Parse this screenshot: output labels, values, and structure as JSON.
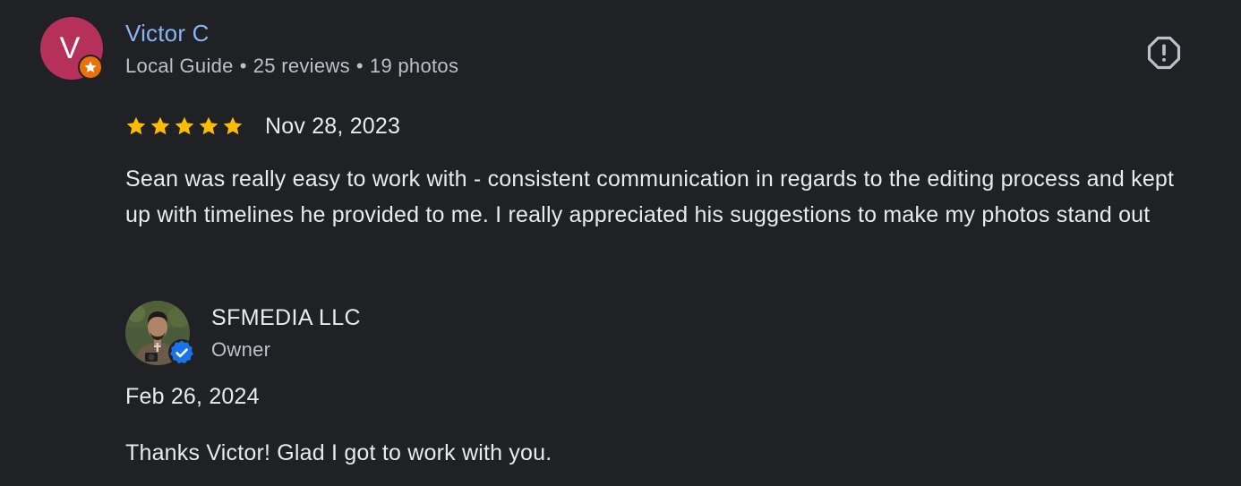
{
  "review": {
    "reviewer": {
      "avatar_letter": "V",
      "avatar_color": "#b5305b",
      "badge_icon": "local-guide-star-icon",
      "name": "Victor C",
      "name_color": "#8ab4f8",
      "level": "Local Guide",
      "reviews": "25 reviews",
      "photos": "19 photos",
      "separator": "•"
    },
    "report_icon": "report-flag-icon",
    "rating": 5,
    "max_rating": 5,
    "star_color": "#fbbc04",
    "date": "Nov 28, 2023",
    "text": "Sean was really easy to work with - consistent communication in regards to the editing process and kept up with timelines he provided to me. I really appreciated his suggestions to make my photos stand out"
  },
  "owner_response": {
    "name": "SFMEDIA LLC",
    "role": "Owner",
    "verified_icon": "verified-badge-icon",
    "verified_color": "#1a73e8",
    "date": "Feb 26, 2024",
    "text": "Thanks Victor! Glad I got to work with you."
  }
}
